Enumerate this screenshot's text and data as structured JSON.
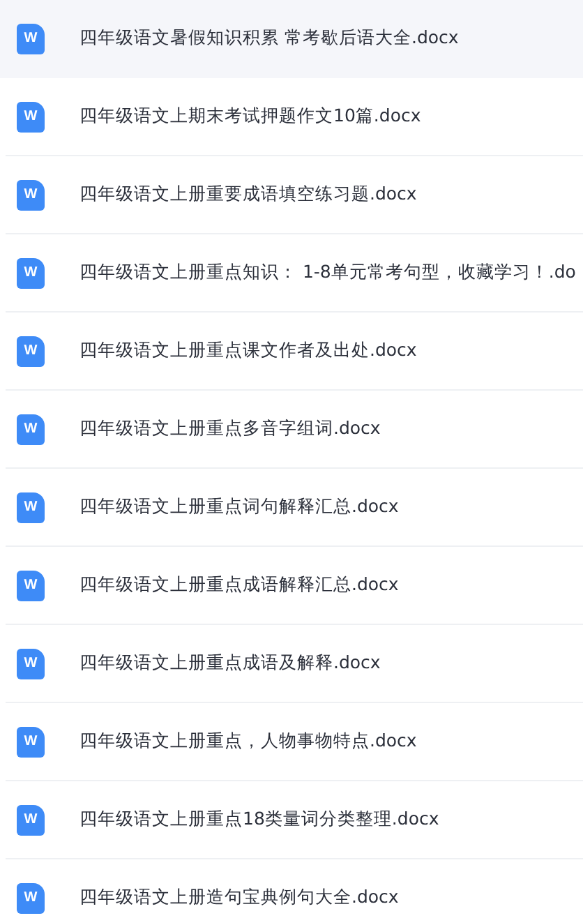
{
  "files": [
    {
      "name": "四年级语文暑假知识积累 常考歇后语大全.docx",
      "icon_text": "W",
      "selected": true
    },
    {
      "name": "四年级语文上期末考试押题作文10篇.docx",
      "icon_text": "W",
      "selected": false
    },
    {
      "name": "四年级语文上册重要成语填空练习题.docx",
      "icon_text": "W",
      "selected": false
    },
    {
      "name": "四年级语文上册重点知识： 1-8单元常考句型，收藏学习！.do",
      "icon_text": "W",
      "selected": false
    },
    {
      "name": "四年级语文上册重点课文作者及出处.docx",
      "icon_text": "W",
      "selected": false
    },
    {
      "name": "四年级语文上册重点多音字组词.docx",
      "icon_text": "W",
      "selected": false
    },
    {
      "name": "四年级语文上册重点词句解释汇总.docx",
      "icon_text": "W",
      "selected": false
    },
    {
      "name": "四年级语文上册重点成语解释汇总.docx",
      "icon_text": "W",
      "selected": false
    },
    {
      "name": "四年级语文上册重点成语及解释.docx",
      "icon_text": "W",
      "selected": false
    },
    {
      "name": "四年级语文上册重点，人物事物特点.docx",
      "icon_text": "W",
      "selected": false
    },
    {
      "name": "四年级语文上册重点18类量词分类整理.docx",
      "icon_text": "W",
      "selected": false
    },
    {
      "name": "四年级语文上册造句宝典例句大全.docx",
      "icon_text": "W",
      "selected": false
    }
  ]
}
